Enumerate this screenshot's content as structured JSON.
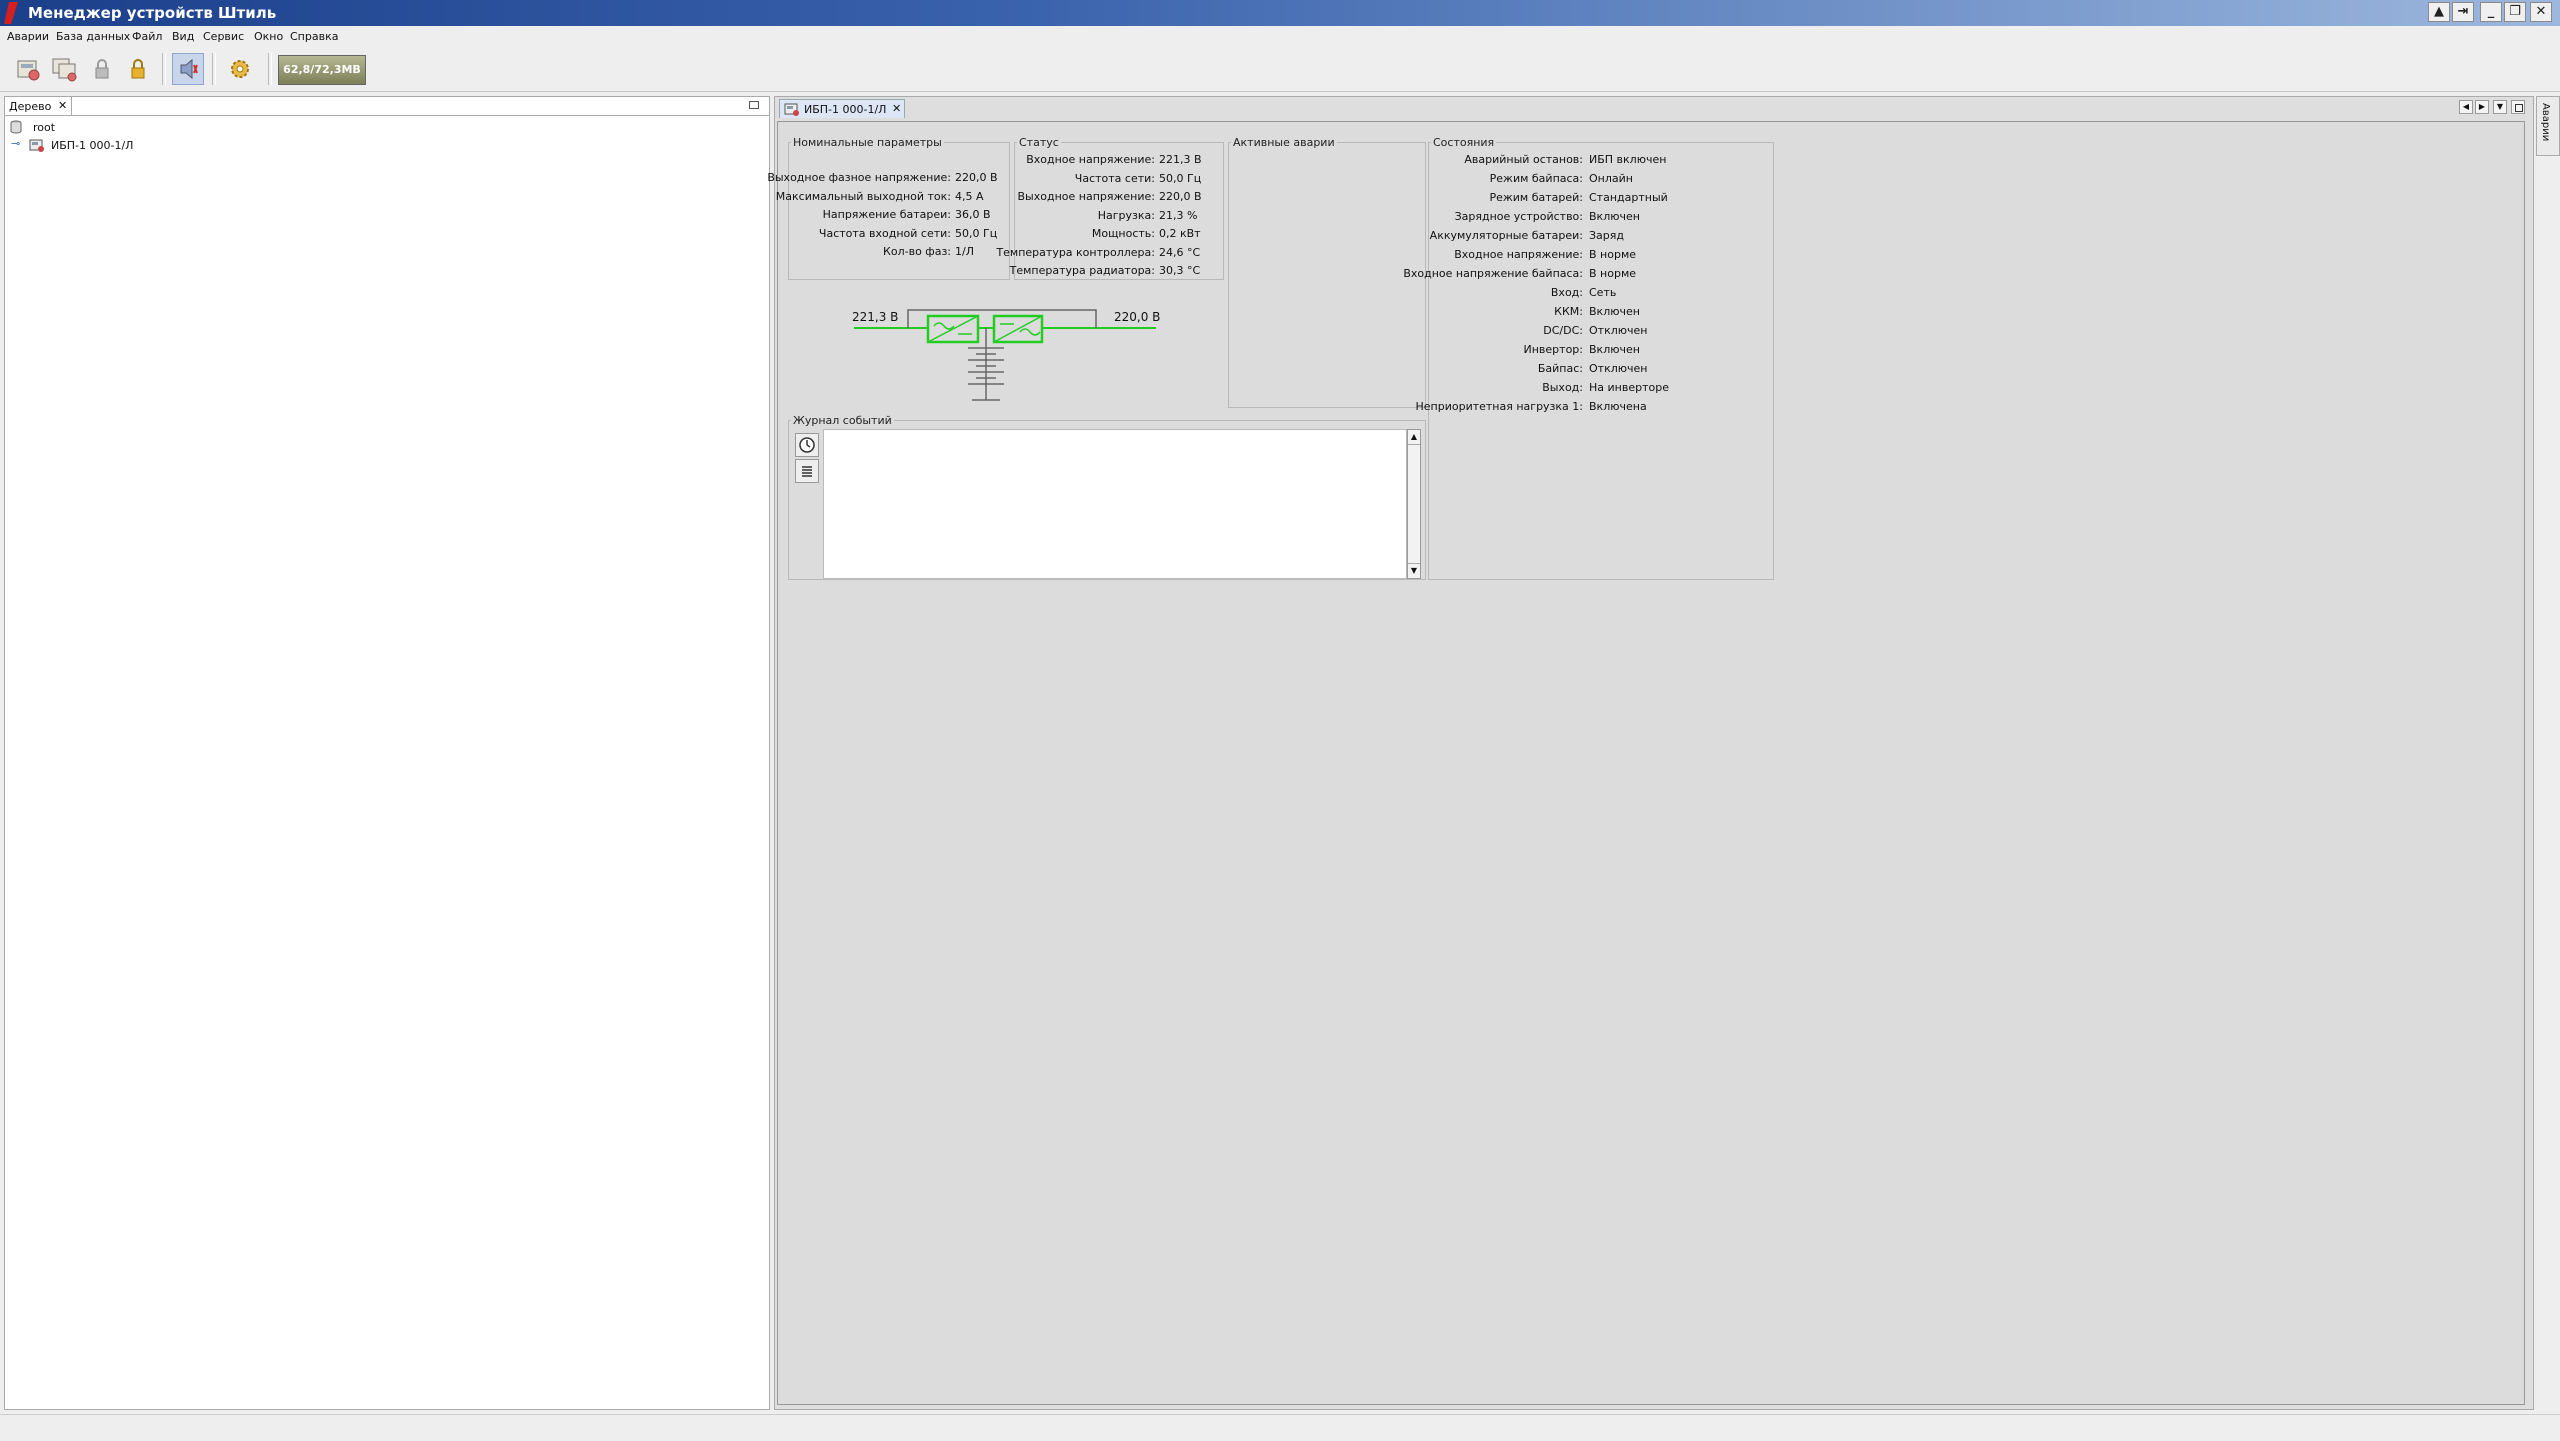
{
  "window": {
    "title": "Менеджер устройств Штиль",
    "controls": [
      "▲",
      "⇥",
      "_",
      "❐",
      "✕"
    ]
  },
  "menu": [
    "Аварии",
    "База данных",
    "Файл",
    "Вид",
    "Сервис",
    "Окно",
    "Справка"
  ],
  "toolbar": {
    "memory": "62,8/72,3MB"
  },
  "tree_panel": {
    "tab_label": "Дерево",
    "close": "✕",
    "items": [
      {
        "label": "root"
      },
      {
        "label": "ИБП-1 000-1/Л"
      }
    ]
  },
  "document": {
    "tab_label": "ИБП-1 000-1/Л",
    "close": "✕",
    "nominal": {
      "title": "Номинальные параметры",
      "rows": [
        {
          "label": "Выходное фазное напряжение:",
          "value": "220,0 В"
        },
        {
          "label": "Максимальный выходной ток:",
          "value": "4,5 А"
        },
        {
          "label": "Напряжение батареи:",
          "value": "36,0 В"
        },
        {
          "label": "Частота входной сети:",
          "value": "50,0 Гц"
        },
        {
          "label": "Кол-во фаз:",
          "value": "1/Л"
        }
      ]
    },
    "status": {
      "title": "Статус",
      "rows": [
        {
          "label": "Входное напряжение:",
          "value": "221,3 В"
        },
        {
          "label": "Частота сети:",
          "value": "50,0 Гц"
        },
        {
          "label": "Выходное напряжение:",
          "value": "220,0 В"
        },
        {
          "label": "Нагрузка:",
          "value": "21,3 %"
        },
        {
          "label": "Мощность:",
          "value": "0,2 кВт"
        },
        {
          "label": "Температура контроллера:",
          "value": "24,6 °C"
        },
        {
          "label": "Температура радиатора:",
          "value": "30,3 °C"
        }
      ]
    },
    "alarms": {
      "title": "Активные аварии"
    },
    "states": {
      "title": "Состояния",
      "rows": [
        {
          "label": "Аварийный останов:",
          "value": "ИБП включен"
        },
        {
          "label": "Режим байпаса:",
          "value": "Онлайн"
        },
        {
          "label": "Режим батарей:",
          "value": "Стандартный"
        },
        {
          "label": "Зарядное устройство:",
          "value": "Включен"
        },
        {
          "label": "Аккумуляторные батареи:",
          "value": "Заряд"
        },
        {
          "label": "Входное напряжение:",
          "value": "В норме"
        },
        {
          "label": "Входное напряжение байпаса:",
          "value": "В норме"
        },
        {
          "label": "Вход:",
          "value": "Сеть"
        },
        {
          "label": "ККМ:",
          "value": "Включен"
        },
        {
          "label": "DC/DC:",
          "value": "Отключен"
        },
        {
          "label": "Инвертор:",
          "value": "Включен"
        },
        {
          "label": "Байпас:",
          "value": "Отключен"
        },
        {
          "label": "Выход:",
          "value": "На инверторе"
        },
        {
          "label": "Неприоритетная нагрузка 1:",
          "value": "Включена"
        }
      ]
    },
    "diagram": {
      "input_voltage": "221,3 В",
      "output_voltage": "220,0 В"
    },
    "log": {
      "title": "Журнал событий"
    }
  },
  "right_strip": {
    "label": "Аварии"
  },
  "colors": {
    "title_start": "#1c3f8a",
    "title_end": "#9db8de",
    "diagram_green": "#22cc22"
  }
}
